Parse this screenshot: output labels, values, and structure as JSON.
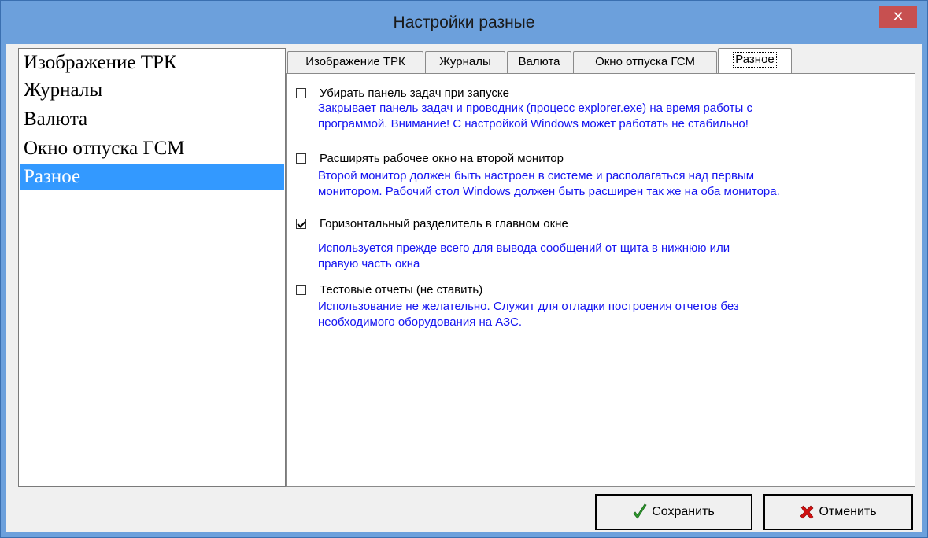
{
  "window": {
    "title": "Настройки разные",
    "close_glyph": "✕"
  },
  "sidebar": {
    "items": [
      {
        "label": "Изображение ТРК"
      },
      {
        "label": "Журналы"
      },
      {
        "label": "Валюта"
      },
      {
        "label": "Окно отпуска ГСМ"
      },
      {
        "label": "Разное",
        "selected": true
      }
    ]
  },
  "tabs": [
    {
      "label": "Изображение ТРК"
    },
    {
      "label": "Журналы"
    },
    {
      "label": "Валюта"
    },
    {
      "label": "Окно отпуска ГСМ"
    },
    {
      "label": "Разное",
      "active": true
    }
  ],
  "options": [
    {
      "label_first": "У",
      "label_rest": "бирать панель задач при запуске",
      "checked": false,
      "desc": [
        "Закрывает панель задач и проводник (процесс explorer.exe) на время работы с",
        "программой. Внимание! С настройкой Windows может работать не стабильно!"
      ]
    },
    {
      "label": "Расширять рабочее окно на второй монитор",
      "checked": false,
      "desc": [
        "Второй монитор должен быть настроен в системе и располагаться над первым",
        "монитором. Рабочий стол Windows должен быть расширен так же на оба монитора."
      ]
    },
    {
      "label": "Горизонтальный разделитель в главном окне",
      "checked": true,
      "desc": [
        "Используется прежде всего для вывода сообщений от щита в нижнюю или",
        "правую часть окна"
      ]
    },
    {
      "label": "Тестовые отчеты (не ставить)",
      "checked": false,
      "desc": [
        "Использование не желательно. Служит для отладки построения отчетов без",
        "необходимого оборудования на АЗС."
      ]
    }
  ],
  "buttons": {
    "save": "Сохранить",
    "cancel": "Отменить"
  },
  "colors": {
    "titlebar": "#6ca0dc",
    "close": "#c75050",
    "selection": "#3399ff",
    "description": "#1414f0"
  }
}
